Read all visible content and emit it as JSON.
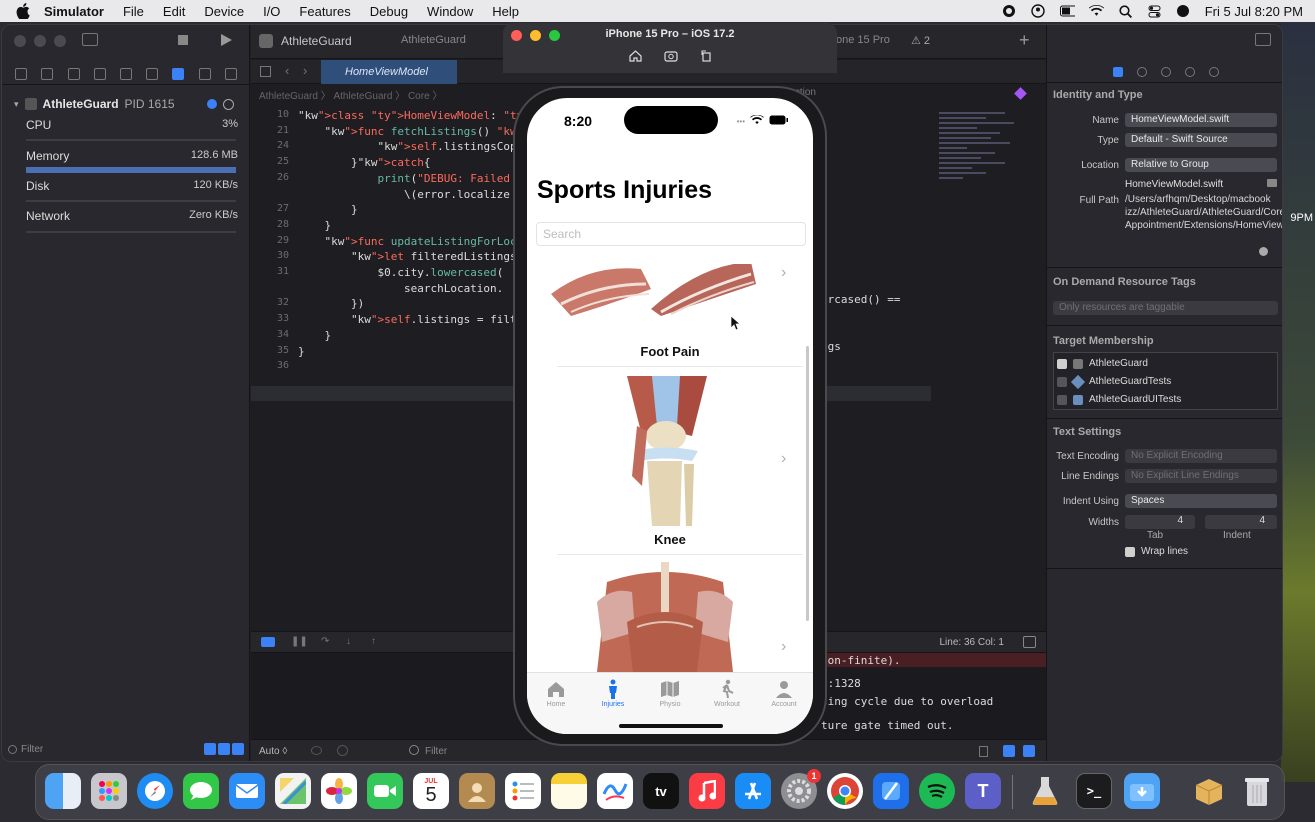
{
  "menubar": {
    "app": "Simulator",
    "items": [
      "File",
      "Edit",
      "Device",
      "I/O",
      "Features",
      "Debug",
      "Window",
      "Help"
    ],
    "datetime": "Fri 5 Jul  8:20 PM"
  },
  "wallpaper_time": "9PM",
  "xcode": {
    "project": "AthleteGuard",
    "scheme": "AthleteGuard",
    "destination": "one 15 Pro",
    "warnings": "2",
    "active_tab": "HomeViewModel",
    "breadcrumbs": "AthleteGuard 〉 AthleteGuard 〉 Core 〉",
    "breadcrumb_right": "No Selection",
    "process": {
      "name": "AthleteGuard",
      "pid": "PID 1615",
      "cpu_label": "CPU",
      "cpu_value": "3%",
      "memory_label": "Memory",
      "memory_value": "128.6 MB",
      "disk_label": "Disk",
      "disk_value": "120 KB/s",
      "network_label": "Network",
      "network_value": "Zero KB/s"
    },
    "left_filter": "Filter",
    "code_lines": [
      {
        "n": "10",
        "t": "class HomeViewModel: ObservableO"
      },
      {
        "n": "21",
        "t": "    func fetchListings() async{"
      },
      {
        "n": "24",
        "t": "            self.listingsCopy ="
      },
      {
        "n": "25",
        "t": "        }catch{"
      },
      {
        "n": "26",
        "t": "            print(\"DEBUG: Failed"
      },
      {
        "n": "",
        "t": "                \\(error.localize"
      },
      {
        "n": "27",
        "t": "        }"
      },
      {
        "n": "28",
        "t": "    }"
      },
      {
        "n": "29",
        "t": "    func updateListingForLocatio"
      },
      {
        "n": "30",
        "t": "        let filteredListings ="
      },
      {
        "n": "31",
        "t": "            $0.city.lowercased("
      },
      {
        "n": "",
        "t": "                searchLocation."
      },
      {
        "n": "32",
        "t": "        })"
      },
      {
        "n": "33",
        "t": "        self.listings = filtere"
      },
      {
        "n": "34",
        "t": "    }"
      },
      {
        "n": "35",
        "t": "}"
      },
      {
        "n": "36",
        "t": ""
      }
    ],
    "code_right_1": "ercased() ==",
    "code_right_2": "ngs",
    "status_linecol": "Line: 36  Col: 1",
    "console": [
      "son-finite).",
      "p:1328",
      "sing cycle due to overload",
      "ture gate timed out."
    ],
    "bottom_auto": "Auto ◊",
    "bottom_filter": "Filter"
  },
  "inspector": {
    "identity_title": "Identity and Type",
    "name_label": "Name",
    "name_value": "HomeViewModel.swift",
    "type_label": "Type",
    "type_value": "Default - Swift Source",
    "location_label": "Location",
    "location_value": "Relative to Group",
    "location_file": "HomeViewModel.swift",
    "fullpath_label": "Full Path",
    "fullpath_value": "/Users/arfhqm/Desktop/macbook izz/AthleteGuard/AthleteGuard/Core/Physio Appointment/Extensions/HomeViewModel.swift",
    "odr_title": "On Demand Resource Tags",
    "odr_placeholder": "Only resources are taggable",
    "target_title": "Target Membership",
    "targets": [
      "AthleteGuard",
      "AthleteGuardTests",
      "AthleteGuardUITests"
    ],
    "text_title": "Text Settings",
    "encoding_label": "Text Encoding",
    "encoding_value": "No Explicit Encoding",
    "endings_label": "Line Endings",
    "endings_value": "No Explicit Line Endings",
    "indent_label": "Indent Using",
    "indent_value": "Spaces",
    "widths_label": "Widths",
    "tab_value": "4",
    "indent_width_value": "4",
    "tab_label": "Tab",
    "indent_label2": "Indent",
    "wrap_label": "Wrap lines"
  },
  "simulator": {
    "title": "iPhone 15 Pro – iOS 17.2",
    "time": "8:20",
    "nav_title": "Sports Injuries",
    "search_placeholder": "Search",
    "items": [
      "Foot Pain",
      "Knee",
      ""
    ],
    "tabs": [
      "Home",
      "Injuries",
      "Physio",
      "Workout",
      "Account"
    ],
    "active_tab": "Injuries"
  },
  "dock": {
    "calendar_month": "JUL",
    "calendar_day": "5",
    "tv_label": "tv",
    "badge": "1"
  },
  "colors": {
    "accent": "#3b82f6",
    "ios_tint": "#1a73e8",
    "keyword": "#fc5fa3",
    "type": "#5dd8ff"
  }
}
